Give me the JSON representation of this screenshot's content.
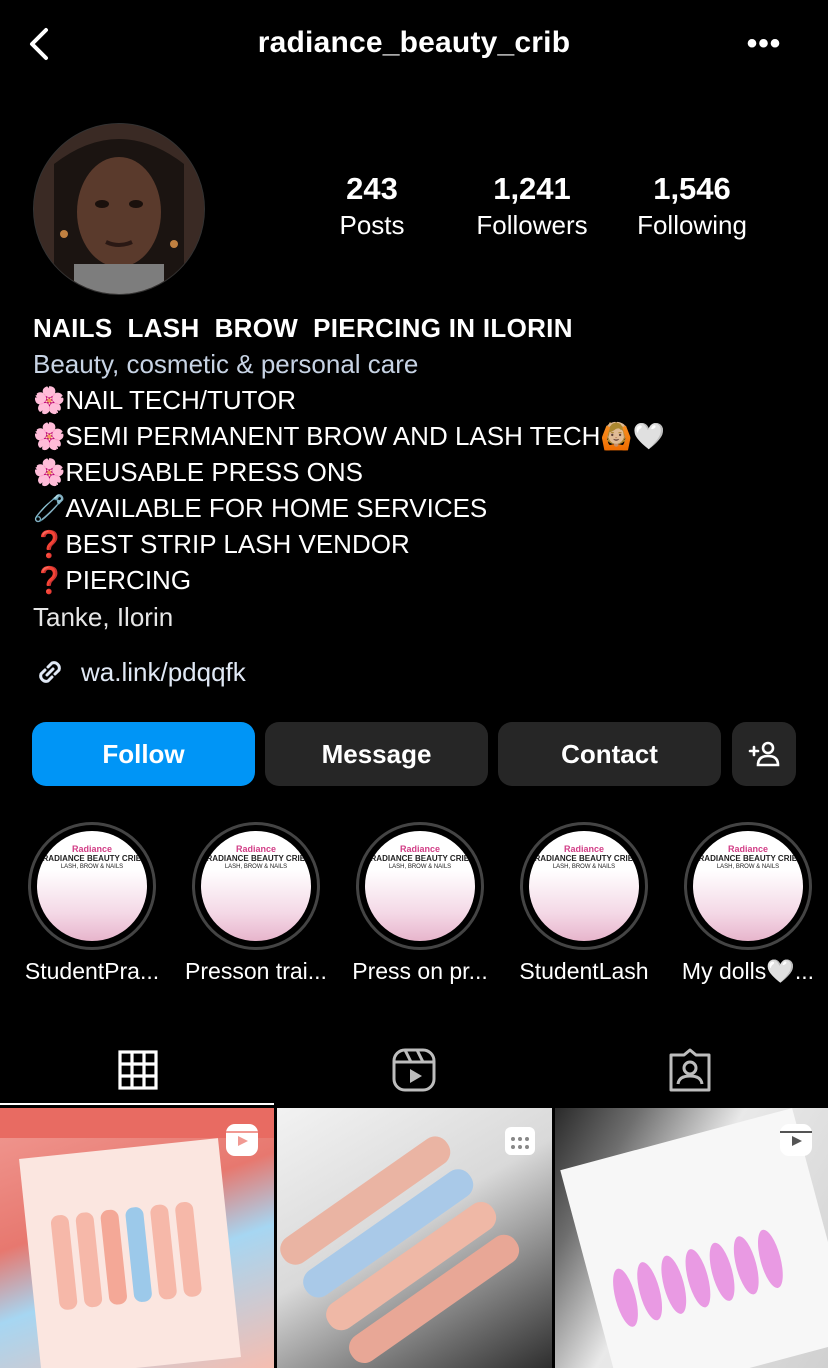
{
  "header": {
    "username": "radiance_beauty_crib",
    "more": "•••"
  },
  "stats": [
    {
      "value": "243",
      "label": "Posts"
    },
    {
      "value": "1,241",
      "label": "Followers"
    },
    {
      "value": "1,546",
      "label": "Following"
    }
  ],
  "bio": {
    "name": "NAILS  LASH  BROW  PIERCING IN ILORIN",
    "category": "Beauty, cosmetic & personal care",
    "lines": [
      "🌸NAIL TECH/TUTOR",
      "🌸SEMI PERMANENT BROW AND LASH TECH🙆🏼🤍",
      "🌸REUSABLE PRESS ONS",
      "🧷AVAILABLE FOR HOME SERVICES",
      "❓BEST STRIP LASH VENDOR",
      "❓PIERCING"
    ],
    "location": "Tanke, Ilorin",
    "link": "wa.link/pdqqfk"
  },
  "buttons": {
    "follow": "Follow",
    "message": "Message",
    "contact": "Contact"
  },
  "highlights": [
    {
      "label": "StudentPra..."
    },
    {
      "label": "Presson trai..."
    },
    {
      "label": "Press on pr..."
    },
    {
      "label": "StudentLash"
    },
    {
      "label": "My dolls🤍..."
    }
  ],
  "highlight_brand": {
    "logo": "Radiance",
    "name": "RADIANCE BEAUTY CRIB",
    "sub": "LASH, BROW & NAILS"
  },
  "tabs": [
    "grid-icon",
    "reels-icon",
    "tagged-icon"
  ],
  "posts": [
    {
      "type": "reel-icon"
    },
    {
      "type": "calendar-icon"
    },
    {
      "type": "reel-icon"
    }
  ]
}
